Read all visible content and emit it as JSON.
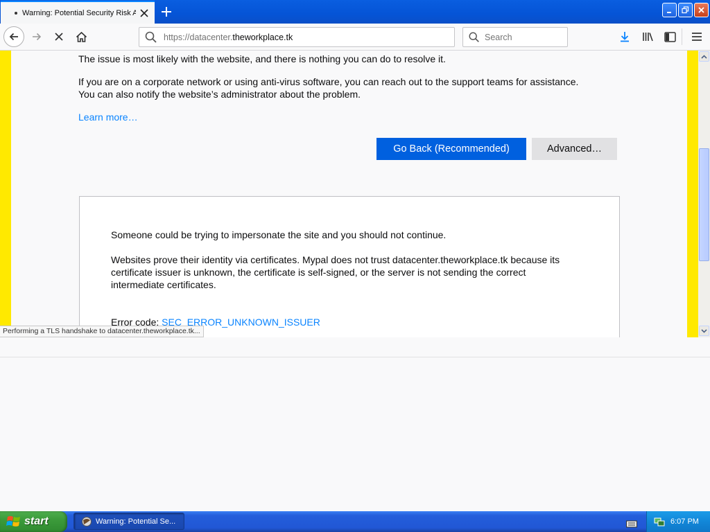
{
  "browser": {
    "tab": {
      "title": "Warning: Potential Security Risk Ahead"
    },
    "url": {
      "prefix": "https://datacenter.",
      "domain": "theworkplace.tk"
    },
    "search": {
      "placeholder": "Search"
    },
    "status": "Performing a TLS handshake to datacenter.theworkplace.tk..."
  },
  "page": {
    "line1": "The issue is most likely with the website, and there is nothing you can do to resolve it.",
    "line2": "If you are on a corporate network or using anti-virus software, you can reach out to the support teams for assistance.",
    "line3": "You can also notify the website’s administrator about the problem.",
    "learn_more": "Learn more…",
    "go_back": "Go Back (Recommended)",
    "advanced": "Advanced…",
    "advanced_panel": {
      "p1": "Someone could be trying to impersonate the site and you should not continue.",
      "p2a": "Websites prove their identity via certificates. Mypal does not trust datacenter.theworkplace.tk because its",
      "p2b": "certificate issuer is unknown, the certificate is self-signed, or the server is not sending the correct",
      "p2c": "intermediate certificates.",
      "error_label": "Error code: ",
      "error_code": "SEC_ERROR_UNKNOWN_ISSUER"
    }
  },
  "taskbar": {
    "start": "start",
    "task": "Warning: Potential Se...",
    "clock": "6:07 PM"
  },
  "colors": {
    "accent": "#0060df",
    "warning_stripe": "#ffe900",
    "link": "#0a84ff"
  }
}
